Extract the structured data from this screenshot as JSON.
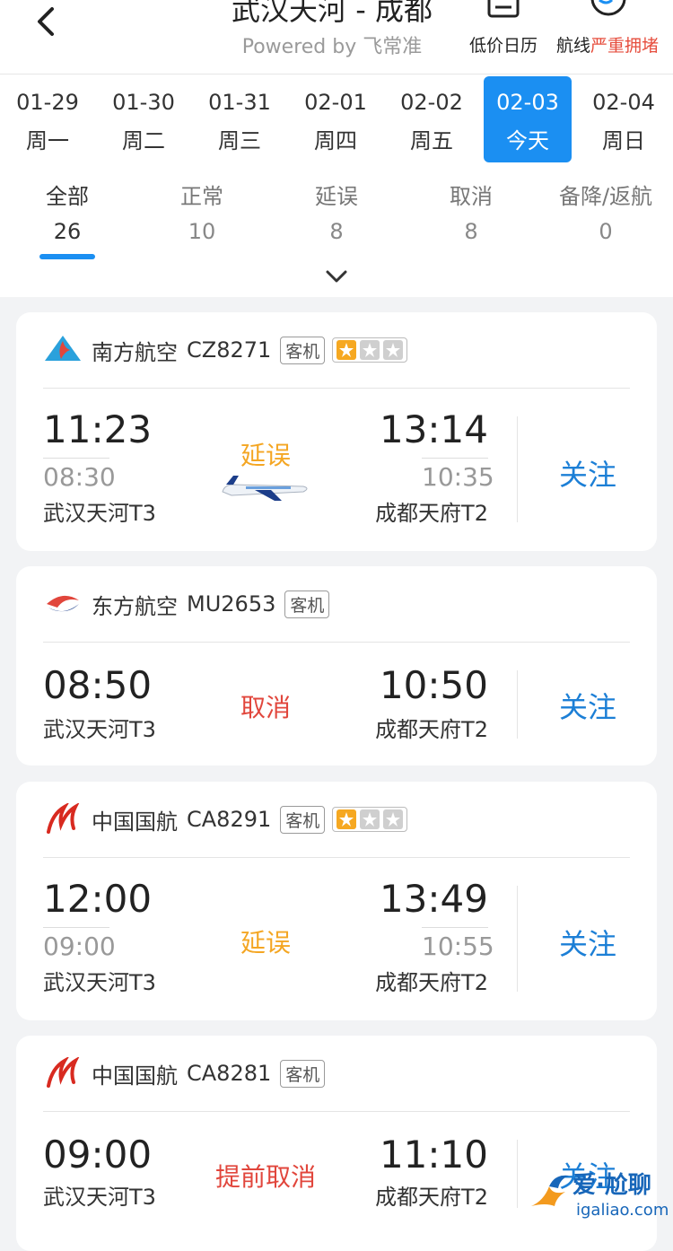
{
  "header": {
    "title": "武汉天河 - 成都",
    "subtitle": "Powered by 飞常准",
    "calendar_label": "低价日历",
    "route_label": "航线",
    "route_status": "严重拥堵"
  },
  "dates": [
    {
      "date": "01-29",
      "day": "周一"
    },
    {
      "date": "01-30",
      "day": "周二"
    },
    {
      "date": "01-31",
      "day": "周三"
    },
    {
      "date": "02-01",
      "day": "周四"
    },
    {
      "date": "02-02",
      "day": "周五"
    },
    {
      "date": "02-03",
      "day": "今天"
    },
    {
      "date": "02-04",
      "day": "周日"
    }
  ],
  "filters": [
    {
      "name": "全部",
      "count": "26"
    },
    {
      "name": "正常",
      "count": "10"
    },
    {
      "name": "延误",
      "count": "8"
    },
    {
      "name": "取消",
      "count": "8"
    },
    {
      "name": "备降/返航",
      "count": "0"
    }
  ],
  "flights": [
    {
      "airline": "南方航空",
      "flight_no": "CZ8271",
      "tag": "客机",
      "rating_stars": 1,
      "dep_time": "11:23",
      "plan_dep": "08:30",
      "dep_airport": "武汉天河T3",
      "arr_time": "13:14",
      "plan_arr": "10:35",
      "arr_airport": "成都天府T2",
      "status": "延误",
      "follow": "关注"
    },
    {
      "airline": "东方航空",
      "flight_no": "MU2653",
      "tag": "客机",
      "dep_time": "08:50",
      "dep_airport": "武汉天河T3",
      "arr_time": "10:50",
      "arr_airport": "成都天府T2",
      "status": "取消",
      "follow": "关注"
    },
    {
      "airline": "中国国航",
      "flight_no": "CA8291",
      "tag": "客机",
      "rating_stars": 1,
      "dep_time": "12:00",
      "plan_dep": "09:00",
      "dep_airport": "武汉天河T3",
      "arr_time": "13:49",
      "plan_arr": "10:55",
      "arr_airport": "成都天府T2",
      "status": "延误",
      "follow": "关注"
    },
    {
      "airline": "中国国航",
      "flight_no": "CA8281",
      "tag": "客机",
      "dep_time": "09:00",
      "dep_airport": "武汉天河T3",
      "arr_time": "11:10",
      "arr_airport": "成都天府T2",
      "status": "提前取消",
      "follow": "关注"
    }
  ],
  "watermark": {
    "text": "爱·尬聊",
    "url": "igaliao.com"
  },
  "colors": {
    "accent": "#1b8ff2",
    "delay": "#f4a623",
    "cancel": "#e1463c",
    "follow": "#1c7fd6"
  }
}
